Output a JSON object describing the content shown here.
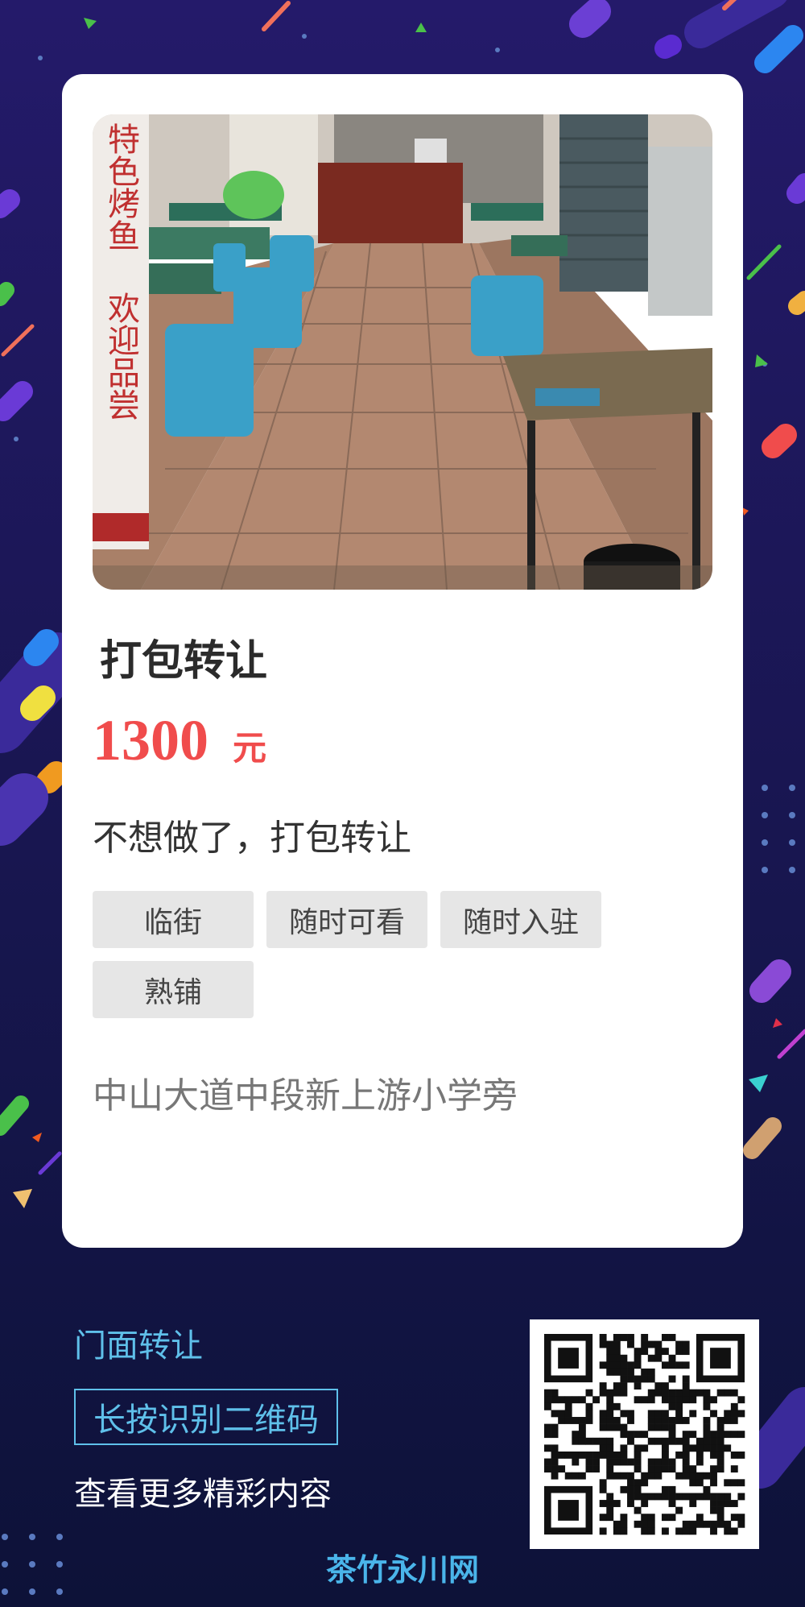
{
  "colors": {
    "accent": "#f04c4c",
    "footer_accent": "#5fc0ea",
    "brand": "#4ab5ea",
    "tag_bg": "#e6e6e6"
  },
  "listing": {
    "title": "打包转让",
    "price": "1300",
    "price_unit": "元",
    "description": "不想做了，打包转让",
    "tags": [
      "临街",
      "随时可看",
      "随时入驻",
      "熟铺"
    ],
    "address": "中山大道中段新上游小学旁",
    "photo_sign_text": "特色烤鱼 欢迎品尝"
  },
  "footer": {
    "title": "门面转让",
    "qr_button": "长按识别二维码",
    "more": "查看更多精彩内容",
    "brand": "茶竹永川网"
  }
}
